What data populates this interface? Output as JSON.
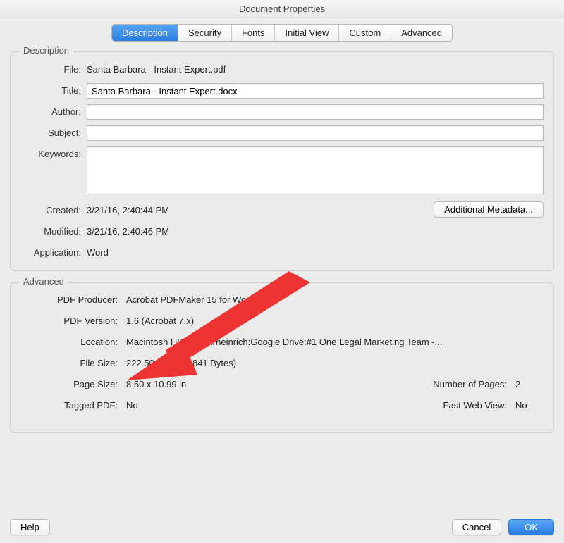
{
  "window": {
    "title": "Document Properties"
  },
  "tabs": {
    "description": "Description",
    "security": "Security",
    "fonts": "Fonts",
    "initial_view": "Initial View",
    "custom": "Custom",
    "advanced": "Advanced"
  },
  "groups": {
    "description": "Description",
    "advanced": "Advanced"
  },
  "labels": {
    "file": "File:",
    "title": "Title:",
    "author": "Author:",
    "subject": "Subject:",
    "keywords": "Keywords:",
    "created": "Created:",
    "modified": "Modified:",
    "application": "Application:",
    "pdf_producer": "PDF Producer:",
    "pdf_version": "PDF Version:",
    "location": "Location:",
    "file_size": "File Size:",
    "page_size": "Page Size:",
    "number_of_pages": "Number of Pages:",
    "tagged_pdf": "Tagged PDF:",
    "fast_web_view": "Fast Web View:"
  },
  "description": {
    "file": "Santa Barbara - Instant Expert.pdf",
    "title": "Santa Barbara - Instant Expert.docx",
    "author": "",
    "subject": "",
    "keywords": "",
    "created": "3/21/16, 2:40:44 PM",
    "modified": "3/21/16, 2:40:46 PM",
    "application": "Word"
  },
  "advanced": {
    "pdf_producer": "Acrobat PDFMaker 15 for Word",
    "pdf_version": "1.6 (Acrobat 7.x)",
    "location": "Macintosh HD:Users:rheinrich:Google Drive:#1 One Legal Marketing Team -...",
    "file_size": "222.50 KB (227,841 Bytes)",
    "page_size": "8.50 x 10.99 in",
    "number_of_pages": "2",
    "tagged_pdf": "No",
    "fast_web_view": "No"
  },
  "buttons": {
    "additional_metadata": "Additional Metadata...",
    "help": "Help",
    "cancel": "Cancel",
    "ok": "OK"
  }
}
